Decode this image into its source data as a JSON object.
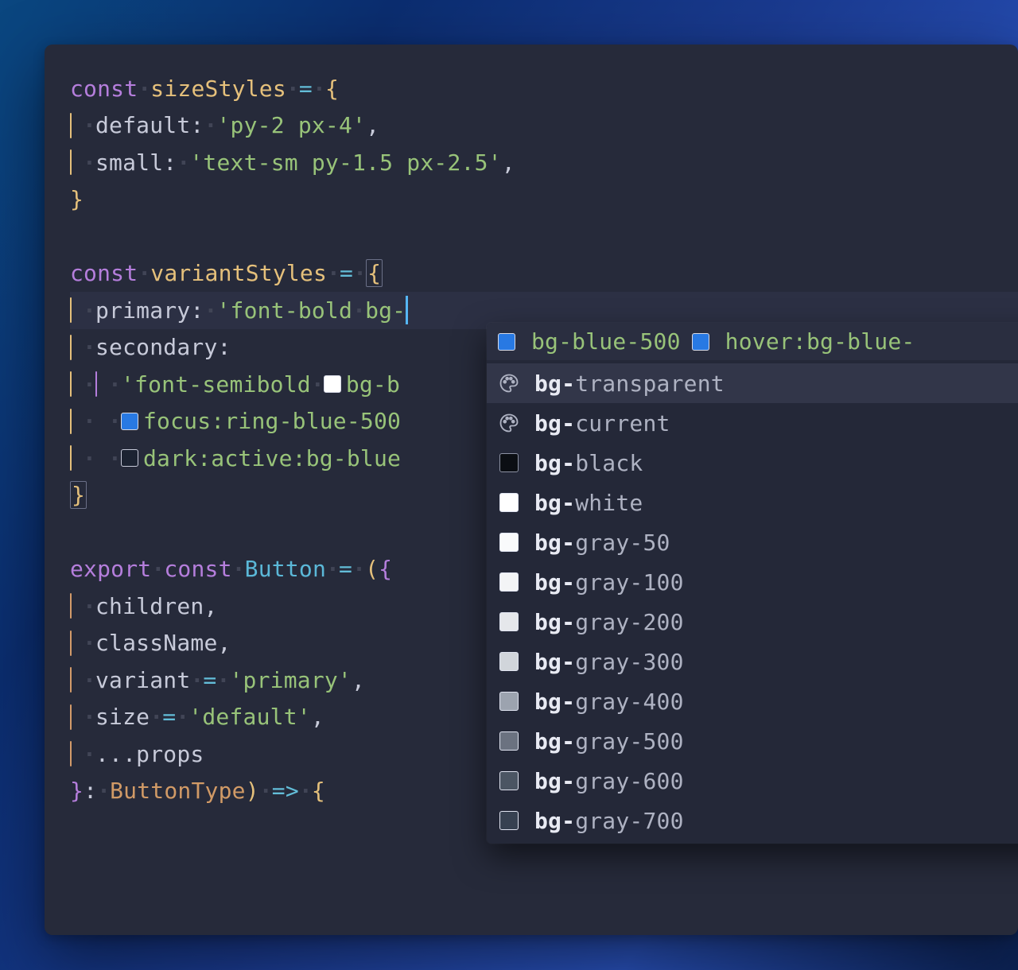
{
  "code": {
    "l1": {
      "kw": "const",
      "ident": "sizeStyles",
      "eq": "=",
      "brace": "{"
    },
    "l2": {
      "prop": "default:",
      "str": "'py-2 px-4'",
      "comma": ","
    },
    "l3": {
      "prop": "small:",
      "str": "'text-sm py-1.5 px-2.5'",
      "comma": ","
    },
    "l4": {
      "brace": "}"
    },
    "l6": {
      "kw": "const",
      "ident": "variantStyles",
      "eq": "=",
      "brace": "{"
    },
    "l7": {
      "prop": "primary:",
      "q": "'",
      "tw1": "font-bold",
      "tw2": "bg-"
    },
    "l8": {
      "prop": "secondary:"
    },
    "l9": {
      "q1": "'",
      "tw1": "font-semibold",
      "tw2": "bg-b"
    },
    "l10": {
      "tw": "focus:ring-blue-500"
    },
    "l11": {
      "tw": "dark:active:bg-blue"
    },
    "l12": {
      "brace": "}"
    },
    "l14": {
      "kw1": "export",
      "kw2": "const",
      "ident": "Button",
      "eq": "=",
      "paren": "(",
      "brace": "{"
    },
    "l15": {
      "prop": "children",
      "comma": ","
    },
    "l16": {
      "prop": "className",
      "comma": ","
    },
    "l17": {
      "prop": "variant",
      "eq": "=",
      "str": "'primary'",
      "comma": ","
    },
    "l18": {
      "prop": "size",
      "eq": "=",
      "str": "'default'",
      "comma": ","
    },
    "l19": {
      "ellipsis": "...props"
    },
    "l20": {
      "brace": "}",
      "colon": ":",
      "type": "ButtonType",
      "paren": ")",
      "arrow": "=>",
      "brace2": "{"
    }
  },
  "hint": {
    "first": "bg-blue-500",
    "second": "hover:bg-blue-"
  },
  "completions": [
    {
      "icon": "palette",
      "prefix": "bg-",
      "rest": "transparent",
      "selected": true
    },
    {
      "icon": "palette",
      "prefix": "bg-",
      "rest": "current"
    },
    {
      "swatch": "#0b0e13",
      "border": "#8d92a3",
      "prefix": "bg-",
      "rest": "black"
    },
    {
      "swatch": "#ffffff",
      "prefix": "bg-",
      "rest": "white"
    },
    {
      "swatch": "#f9fafb",
      "prefix": "bg-",
      "rest": "gray-50"
    },
    {
      "swatch": "#f3f4f6",
      "prefix": "bg-",
      "rest": "gray-100"
    },
    {
      "swatch": "#e5e7eb",
      "prefix": "bg-",
      "rest": "gray-200"
    },
    {
      "swatch": "#d1d5db",
      "prefix": "bg-",
      "rest": "gray-300"
    },
    {
      "swatch": "#9ca3af",
      "prefix": "bg-",
      "rest": "gray-400"
    },
    {
      "swatch": "#6b7280",
      "prefix": "bg-",
      "rest": "gray-500"
    },
    {
      "swatch": "#4b5563",
      "prefix": "bg-",
      "rest": "gray-600"
    },
    {
      "swatch": "#374151",
      "prefix": "bg-",
      "rest": "gray-700"
    }
  ],
  "colors": {
    "swatch_white": "#ffffff",
    "swatch_blue": "#2879e3",
    "swatch_dark": "#1c2332"
  }
}
